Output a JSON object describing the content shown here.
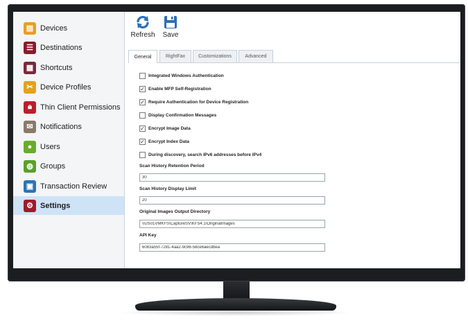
{
  "sidebar": {
    "items": [
      {
        "label": "Devices",
        "icon": "devices-icon",
        "color": "#e8a020"
      },
      {
        "label": "Destinations",
        "icon": "destinations-icon",
        "color": "#8b1a2b"
      },
      {
        "label": "Shortcuts",
        "icon": "shortcuts-icon",
        "color": "#7a2a3a"
      },
      {
        "label": "Device Profiles",
        "icon": "device-profiles-icon",
        "color": "#e3a21a"
      },
      {
        "label": "Thin Client Permissions",
        "icon": "lock-icon",
        "color": "#b8202a"
      },
      {
        "label": "Notifications",
        "icon": "notifications-icon",
        "color": "#8a7a6a"
      },
      {
        "label": "Users",
        "icon": "users-icon",
        "color": "#6aab2e"
      },
      {
        "label": "Groups",
        "icon": "groups-icon",
        "color": "#5aa02a"
      },
      {
        "label": "Transaction Review",
        "icon": "transaction-review-icon",
        "color": "#2a74b8"
      },
      {
        "label": "Settings",
        "icon": "settings-icon",
        "color": "#a01a2a"
      }
    ],
    "active_index": 9
  },
  "toolbar": {
    "refresh_label": "Refresh",
    "save_label": "Save",
    "accent": "#2b6fb5"
  },
  "tabs": [
    {
      "label": "General",
      "active": true
    },
    {
      "label": "RightFax",
      "active": false
    },
    {
      "label": "Customizations",
      "active": false
    },
    {
      "label": "Advanced",
      "active": false
    }
  ],
  "form": {
    "checkboxes": [
      {
        "label": "Integrated Windows Authentication",
        "checked": false
      },
      {
        "label": "Enable MFP Self-Registration",
        "checked": true
      },
      {
        "label": "Require Authentication for Device Registration",
        "checked": true
      },
      {
        "label": "Display Confirmation Messages",
        "checked": false
      },
      {
        "label": "Encrypt Image Data",
        "checked": true
      },
      {
        "label": "Encrypt Index Data",
        "checked": true
      },
      {
        "label": "During discovery, search IPv6 addresses before IPv4",
        "checked": false
      }
    ],
    "fields": [
      {
        "label": "Scan History Retention Period",
        "value": "30"
      },
      {
        "label": "Scan History Display Limit",
        "value": "20"
      },
      {
        "label": "Original Images Output Directory",
        "value": "\\\\US01VMKFS\\CaptureSV\\KFS4.1\\OriginalImages"
      },
      {
        "label": "API Key",
        "value": "6083a55f-7281-4aa2-9c96-58ce6aecdbea"
      }
    ]
  }
}
